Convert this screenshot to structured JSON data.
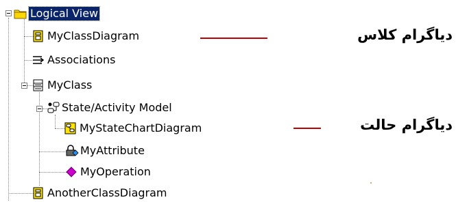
{
  "tree": {
    "root": {
      "label": "Logical View",
      "icon": "folder-icon"
    },
    "items": [
      {
        "label": "MyClassDiagram",
        "icon": "class-diagram-icon"
      },
      {
        "label": "Associations",
        "icon": "associations-icon"
      },
      {
        "label": "MyClass",
        "icon": "class-icon"
      },
      {
        "label": "State/Activity Model",
        "icon": "state-activity-model-icon"
      },
      {
        "label": "MyStateChartDiagram",
        "icon": "statechart-diagram-icon"
      },
      {
        "label": "MyAttribute",
        "icon": "attribute-icon"
      },
      {
        "label": "MyOperation",
        "icon": "operation-icon"
      },
      {
        "label": "AnotherClassDiagram",
        "icon": "class-diagram-icon"
      }
    ]
  },
  "annotations": {
    "class_diagram": "دیاگرام کلاس",
    "state_diagram": "دیاگرام حالت"
  },
  "colors": {
    "selection": "#0a246a",
    "arrow_line": "#c00000",
    "folder": "#ffd700",
    "operation": "#cc00cc"
  }
}
